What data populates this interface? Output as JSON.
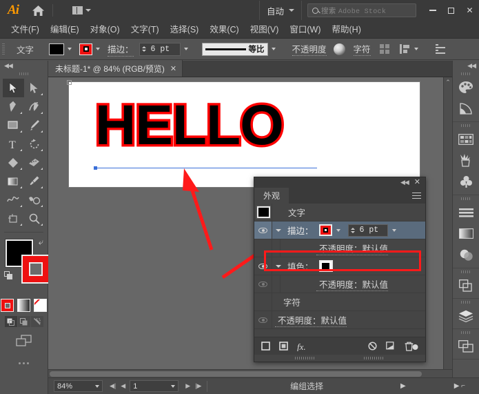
{
  "app": {
    "name": "Adobe Illustrator",
    "logo_text": "Ai",
    "home_icon": "home-icon",
    "arrange_icon": "arrange-documents-icon",
    "auto_label": "自动",
    "search_placeholder_cn": "搜索",
    "search_placeholder_en": "Adobe Stock",
    "window_minimize": "–",
    "window_maximize": "▢",
    "window_close": "✕"
  },
  "menubar": {
    "items": [
      {
        "label": "文件(F)"
      },
      {
        "label": "编辑(E)"
      },
      {
        "label": "对象(O)"
      },
      {
        "label": "文字(T)"
      },
      {
        "label": "选择(S)"
      },
      {
        "label": "效果(C)"
      },
      {
        "label": "视图(V)"
      },
      {
        "label": "窗口(W)"
      },
      {
        "label": "帮助(H)"
      }
    ]
  },
  "options_bar": {
    "context_label": "文字",
    "fill_swatch": "#000000",
    "stroke_swatch": "#ee1111",
    "stroke_label": "描边：",
    "stroke_weight": "6 pt",
    "profile_label": "等比",
    "opacity_label": "不透明度",
    "recolor_icon": "recolor-artwork-icon",
    "character_label": "字符",
    "align_icon": "align-icon",
    "distribute_icon": "distribute-icon",
    "document_setup_icon": "options-list-icon"
  },
  "toolbar": {
    "tools": [
      {
        "name": "selection-tool",
        "active": true
      },
      {
        "name": "direct-selection-tool",
        "active": false
      },
      {
        "name": "pen-tool",
        "active": false
      },
      {
        "name": "curvature-tool",
        "active": false
      },
      {
        "name": "rectangle-tool",
        "active": false
      },
      {
        "name": "paintbrush-tool",
        "active": false
      },
      {
        "name": "type-tool",
        "active": false
      },
      {
        "name": "rotate-tool",
        "active": false
      },
      {
        "name": "shape-builder-tool",
        "active": false
      },
      {
        "name": "width-tool",
        "active": false
      },
      {
        "name": "gradient-tool",
        "active": false
      },
      {
        "name": "eyedropper-tool",
        "active": false
      },
      {
        "name": "blend-tool",
        "active": false
      },
      {
        "name": "symbol-sprayer-tool",
        "active": false
      },
      {
        "name": "artboard-tool",
        "active": false
      },
      {
        "name": "zoom-tool",
        "active": false
      }
    ],
    "fill_color": "#000000",
    "stroke_color": "#ee1111",
    "swap_icon": "swap-fill-stroke-icon",
    "default_colors_icon": "default-fill-stroke-icon",
    "color_mode_icon": "color-mode-icon",
    "gradient_mode_icon": "gradient-mode-icon",
    "none_mode_icon": "none-mode-icon",
    "draw_modes": [
      "draw-normal",
      "draw-behind",
      "draw-inside"
    ],
    "screen_mode_icon": "screen-mode-icon",
    "more_tools_icon": "more-tools-icon"
  },
  "document": {
    "tab_title": "未标题-1* @ 84% (RGB/预览)",
    "tab_close": "✕",
    "artwork_text": "HELLO",
    "artwork_fill": "#000000",
    "artwork_stroke": "#ff0000"
  },
  "appearance_panel": {
    "collapse_icon": "collapse-panel-icon",
    "close_icon": "close-panel-icon",
    "tab_label": "外观",
    "menu_icon": "panel-menu-icon",
    "rows": [
      {
        "type": "header",
        "label": "文字",
        "swatch": "#000000",
        "eye": false,
        "chevron": false
      },
      {
        "type": "stroke",
        "label": "描边：",
        "swatch": "#ee1111",
        "value": "6 pt",
        "eye": true,
        "chevron": true,
        "selected": true
      },
      {
        "type": "sub",
        "label": "不透明度：默认值",
        "eye": false,
        "dim": true
      },
      {
        "type": "fill",
        "label": "填色：",
        "swatch": "#000000",
        "eye": true,
        "chevron": true
      },
      {
        "type": "sub",
        "label": "不透明度：默认值",
        "eye": true,
        "dim": true
      },
      {
        "type": "group",
        "label": "字符",
        "eye": false
      },
      {
        "type": "sub2",
        "label": "不透明度：默认值",
        "eye": true,
        "dim": true
      }
    ],
    "footer_icons": [
      "add-new-stroke-icon",
      "add-new-fill-icon",
      "add-fx-icon",
      "clear-appearance-icon",
      "duplicate-item-icon",
      "delete-item-icon"
    ],
    "highlight_color": "#ff1a1a"
  },
  "right_dock": {
    "groups": [
      {
        "icons": [
          "color-palette-icon",
          "color-guide-icon"
        ]
      },
      {
        "icons": [
          "swatches-icon",
          "brushes-icon",
          "symbols-icon"
        ]
      },
      {
        "icons": [
          "align-panel-icon",
          "gradient-panel-icon",
          "transparency-panel-icon"
        ]
      },
      {
        "icons": [
          "pathfinder-panel-icon"
        ]
      },
      {
        "icons": [
          "layers-panel-icon"
        ]
      },
      {
        "icons": [
          "artboards-panel-icon"
        ]
      }
    ]
  },
  "statusbar": {
    "zoom_level": "84%",
    "page_number": "1",
    "status_text": "编组选择",
    "first_page_icon": "first-page-icon",
    "prev_page_icon": "prev-page-icon",
    "next_page_icon": "next-page-icon",
    "last_page_icon": "last-page-icon",
    "play_icon": "play-icon"
  },
  "annotations": {
    "arrow_color": "#ff1a1a",
    "arrow_1": "arrow-pointing-to-artwork",
    "arrow_2": "arrow-pointing-to-stroke-row"
  }
}
